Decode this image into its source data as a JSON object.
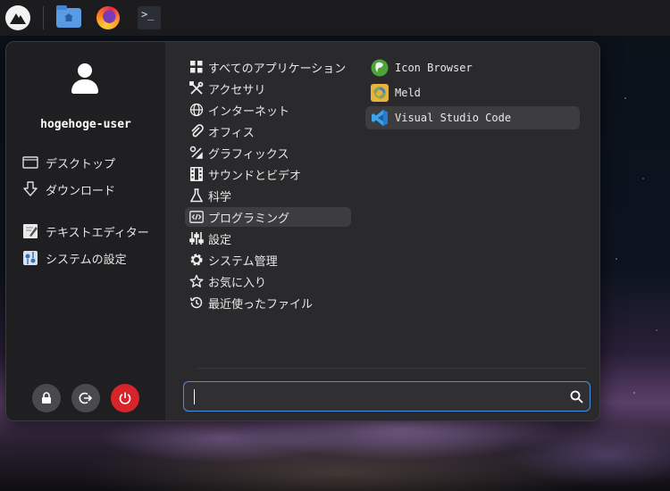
{
  "user": {
    "name": "hogehoge-user"
  },
  "places": [
    {
      "label": "デスクトップ"
    },
    {
      "label": "ダウンロード"
    }
  ],
  "favorites": [
    {
      "label": "テキストエディター"
    },
    {
      "label": "システムの設定"
    }
  ],
  "categories": [
    {
      "label": "すべてのアプリケーション",
      "icon": "grid-icon"
    },
    {
      "label": "アクセサリ",
      "icon": "tools-icon"
    },
    {
      "label": "インターネット",
      "icon": "globe-icon"
    },
    {
      "label": "オフィス",
      "icon": "paperclip-icon"
    },
    {
      "label": "グラフィックス",
      "icon": "palette-icon"
    },
    {
      "label": "サウンドとビデオ",
      "icon": "film-icon"
    },
    {
      "label": "科学",
      "icon": "flask-icon"
    },
    {
      "label": "プログラミング",
      "icon": "code-icon"
    },
    {
      "label": "設定",
      "icon": "sliders-icon"
    },
    {
      "label": "システム管理",
      "icon": "gear-icon"
    },
    {
      "label": "お気に入り",
      "icon": "star-icon"
    },
    {
      "label": "最近使ったファイル",
      "icon": "history-icon"
    }
  ],
  "selected_category": "プログラミング",
  "apps": [
    {
      "label": "Icon Browser",
      "icon": "gimp-icon"
    },
    {
      "label": "Meld",
      "icon": "meld-icon"
    },
    {
      "label": "Visual Studio Code",
      "icon": "vscode-icon"
    }
  ],
  "selected_app": "Visual Studio Code",
  "search": {
    "value": "",
    "placeholder": ""
  },
  "colors": {
    "accent": "#4c90e0",
    "power": "#d6242a",
    "panel": "#1c1c1e"
  },
  "taskbar": {
    "apps": [
      {
        "icon": "home-folder-icon"
      },
      {
        "icon": "firefox-icon"
      },
      {
        "icon": "terminal-icon",
        "label": ">_"
      }
    ]
  }
}
